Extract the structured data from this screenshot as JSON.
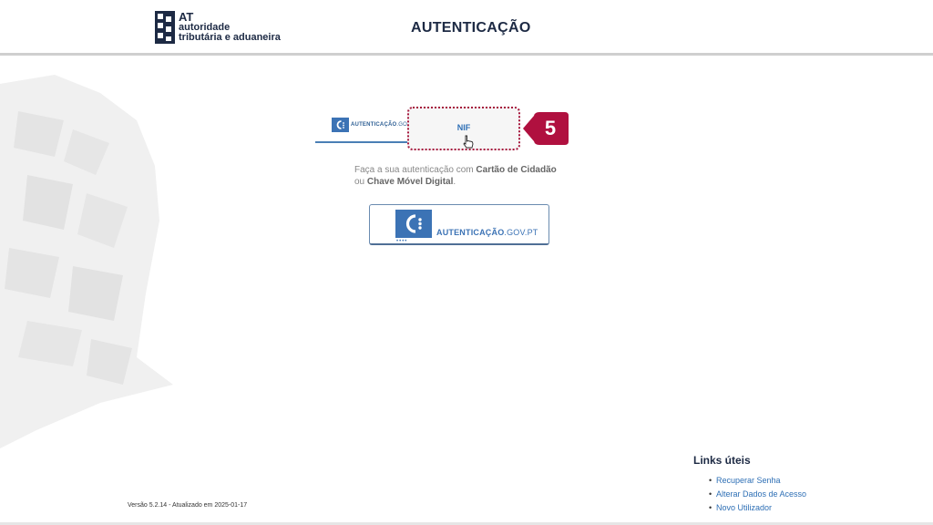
{
  "header": {
    "logo": {
      "line1": "AT",
      "line2": "autoridade",
      "line3": "tributária e aduaneira"
    },
    "title": "AUTENTICAÇÃO"
  },
  "tabs": {
    "gov": {
      "text_bold": "AUTENTICAÇÃO",
      "text_light": ".GOV.PT"
    },
    "nif": {
      "label": "NIF"
    },
    "step_badge": "5"
  },
  "description": {
    "part1": "Faça a sua autenticação com ",
    "strong1": "Cartão de Cidadão",
    "part2": "ou ",
    "strong2": "Chave Móvel Digital",
    "part3": "."
  },
  "gov_button": {
    "text_bold": "AUTENTICAÇÃO",
    "text_light": ".GOV.PT"
  },
  "footer": {
    "version": "Versão 5.2.14 - Atualizado em 2025-01-17",
    "links_title": "Links úteis",
    "links": [
      "Recuperar Senha",
      "Alterar Dados de Acesso",
      "Novo Utilizador"
    ]
  },
  "colors": {
    "brand_navy": "#1d2a44",
    "gov_blue": "#3c73b5",
    "link_blue": "#2e6fb5",
    "highlight_crimson": "#a6173d"
  },
  "icons": {
    "logo": "at-emblem-icon",
    "cursor": "hand-pointer-icon",
    "gov": "autenticacao-gov-icon"
  }
}
